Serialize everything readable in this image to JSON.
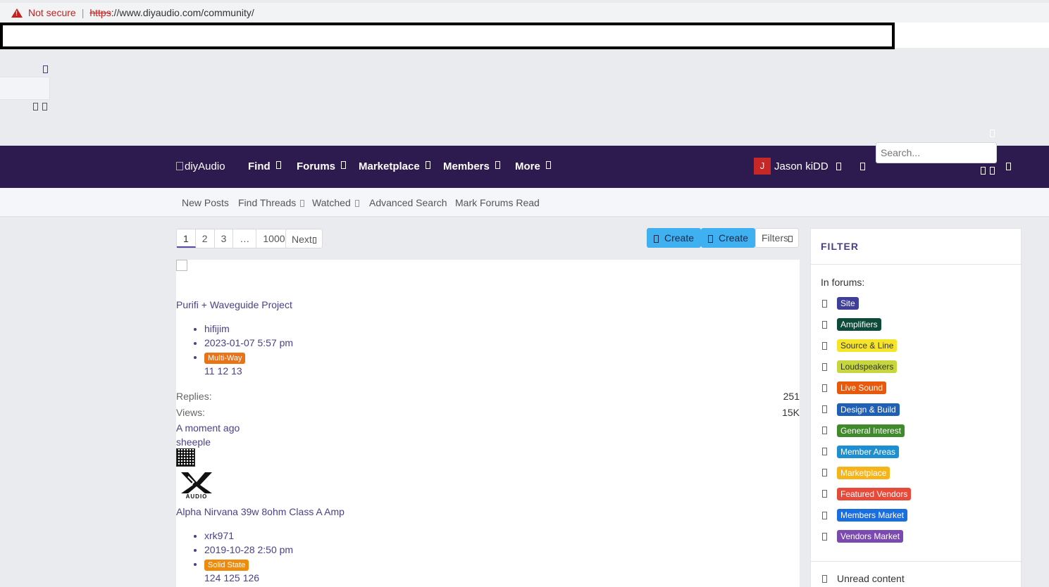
{
  "browser": {
    "security_label": "Not secure",
    "url_scheme": "https",
    "url_rest": "://www.diyaudio.com/community/"
  },
  "nav": {
    "logo_alt": "diyAudio",
    "items": [
      "Find",
      "Forums",
      "Marketplace",
      "Members",
      "More"
    ],
    "user_initial": "J",
    "user_name": "Jason kiDD",
    "search_placeholder": "Search...",
    "bg_color": "#2d1b4f"
  },
  "subnav": {
    "items": [
      "New Posts",
      "Find Threads",
      "Watched",
      "Advanced Search",
      "Mark Forums Read"
    ]
  },
  "pagination": {
    "pages": [
      "1",
      "2",
      "3",
      "…",
      "1000"
    ],
    "next_label": "Next"
  },
  "actions": {
    "create_1": "Create",
    "create_2": "Create",
    "filters": "Filters"
  },
  "threads": [
    {
      "title": "Purifi + Waveguide Project",
      "author": "hifijim",
      "date": "2023-01-07 5:57 pm",
      "prefix": "Multi-Way",
      "prefix_color": "#e8741a",
      "pages": [
        "11",
        "12",
        "13"
      ],
      "replies_label": "Replies:",
      "replies": "251",
      "views_label": "Views:",
      "views": "15K",
      "last_post_time": "A moment ago",
      "last_post_user": "sheeple"
    },
    {
      "title": "Alpha Nirvana 39w 8ohm Class A Amp",
      "author": "xrk971",
      "date": "2019-10-28 2:50 pm",
      "prefix": "Solid State",
      "prefix_color": "#ef8b0c",
      "pages": [
        "124",
        "125",
        "126"
      ],
      "logo_text": "AUDIO"
    }
  ],
  "filter": {
    "title": "FILTER",
    "in_forums_label": "In forums:",
    "forums": [
      {
        "name": "Site",
        "color": "#3f3f9a",
        "text_color": "#ffffff"
      },
      {
        "name": "Amplifiers",
        "color": "#0d4a3a",
        "text_color": "#ffffff"
      },
      {
        "name": "Source & Line",
        "color": "#f5e52a",
        "text_color": "#333333"
      },
      {
        "name": "Loudspeakers",
        "color": "#c6d63c",
        "text_color": "#333333"
      },
      {
        "name": "Live Sound",
        "color": "#e8590c",
        "text_color": "#ffffff"
      },
      {
        "name": "Design & Build",
        "color": "#1f5fb4",
        "text_color": "#ffffff"
      },
      {
        "name": "General Interest",
        "color": "#3f8a2a",
        "text_color": "#ffffff"
      },
      {
        "name": "Member Areas",
        "color": "#1d8fd1",
        "text_color": "#ffffff"
      },
      {
        "name": "Marketplace",
        "color": "#f5b41a",
        "text_color": "#ffffff"
      },
      {
        "name": "Featured Vendors",
        "color": "#e84a3a",
        "text_color": "#ffffff"
      },
      {
        "name": "Members Market",
        "color": "#1a6fe0",
        "text_color": "#ffffff"
      },
      {
        "name": "Vendors Market",
        "color": "#7a4ab0",
        "text_color": "#ffffff"
      }
    ],
    "unread_label": "Unread content"
  }
}
